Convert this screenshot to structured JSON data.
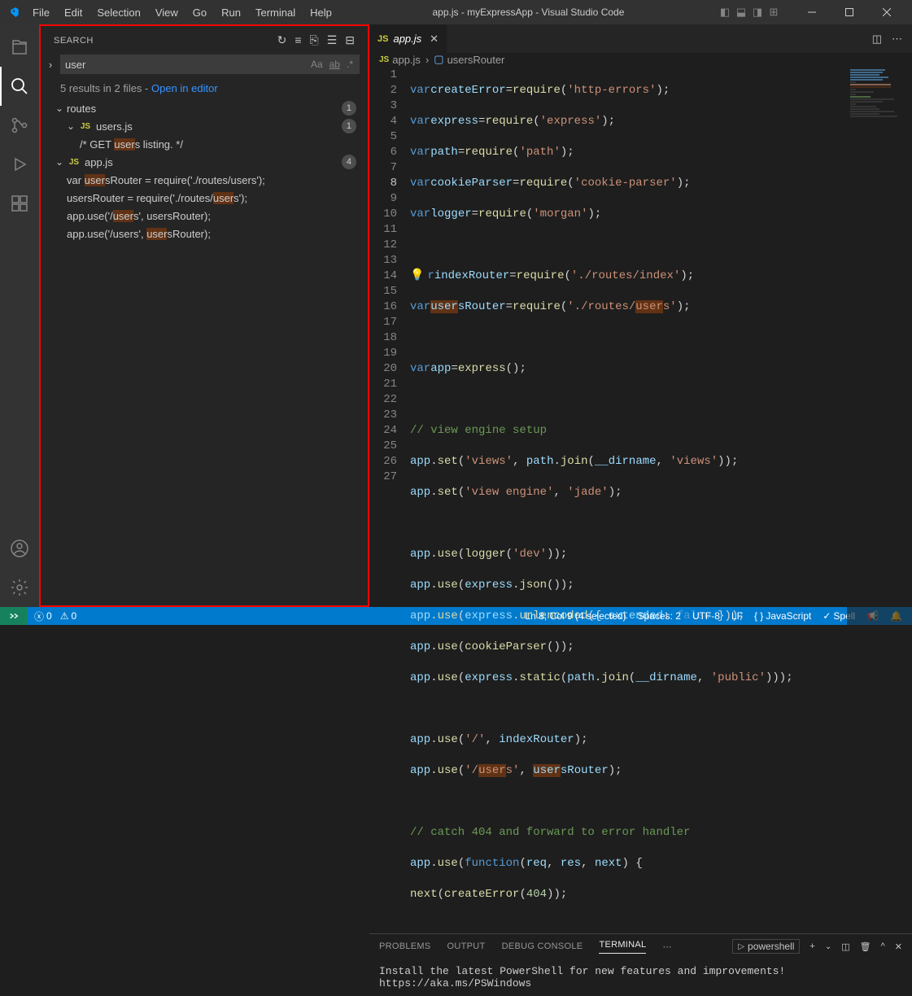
{
  "titlebar": {
    "title": "app.js - myExpressApp - Visual Studio Code",
    "menu": [
      "File",
      "Edit",
      "Selection",
      "View",
      "Go",
      "Run",
      "Terminal",
      "Help"
    ]
  },
  "activity": {
    "items": [
      "explorer",
      "search",
      "scm",
      "debug",
      "extensions"
    ],
    "bottom": [
      "account",
      "settings"
    ]
  },
  "search": {
    "title": "SEARCH",
    "query": "user",
    "summary_prefix": "5 results in 2 files - ",
    "summary_link": "Open in editor",
    "results": {
      "folder": "routes",
      "folder_badge": "1",
      "file1": "users.js",
      "file1_badge": "1",
      "file1_match": "/* GET users listing. */",
      "file2": "app.js",
      "file2_badge": "4",
      "file2_matches": [
        "var usersRouter = require('./routes/users');",
        "usersRouter = require('./routes/users');",
        "app.use('/users', usersRouter);",
        "app.use('/users', usersRouter);"
      ]
    }
  },
  "tabs": {
    "active": "app.js"
  },
  "breadcrumb": {
    "file": "app.js",
    "symbol": "usersRouter"
  },
  "editor": {
    "lines": 27,
    "active_line": 8
  },
  "panel": {
    "tabs": [
      "PROBLEMS",
      "OUTPUT",
      "DEBUG CONSOLE",
      "TERMINAL"
    ],
    "active": "TERMINAL",
    "shell": "powershell",
    "content": "Install the latest PowerShell for new features and improvements! https://aka.ms/PSWindows"
  },
  "statusbar": {
    "errors": "0",
    "warnings": "0",
    "cursor": "Ln 8, Col 9 (4 selected)",
    "spaces": "Spaces: 2",
    "encoding": "UTF-8",
    "eol": "LF",
    "language": "JavaScript",
    "spell": "Spell"
  }
}
